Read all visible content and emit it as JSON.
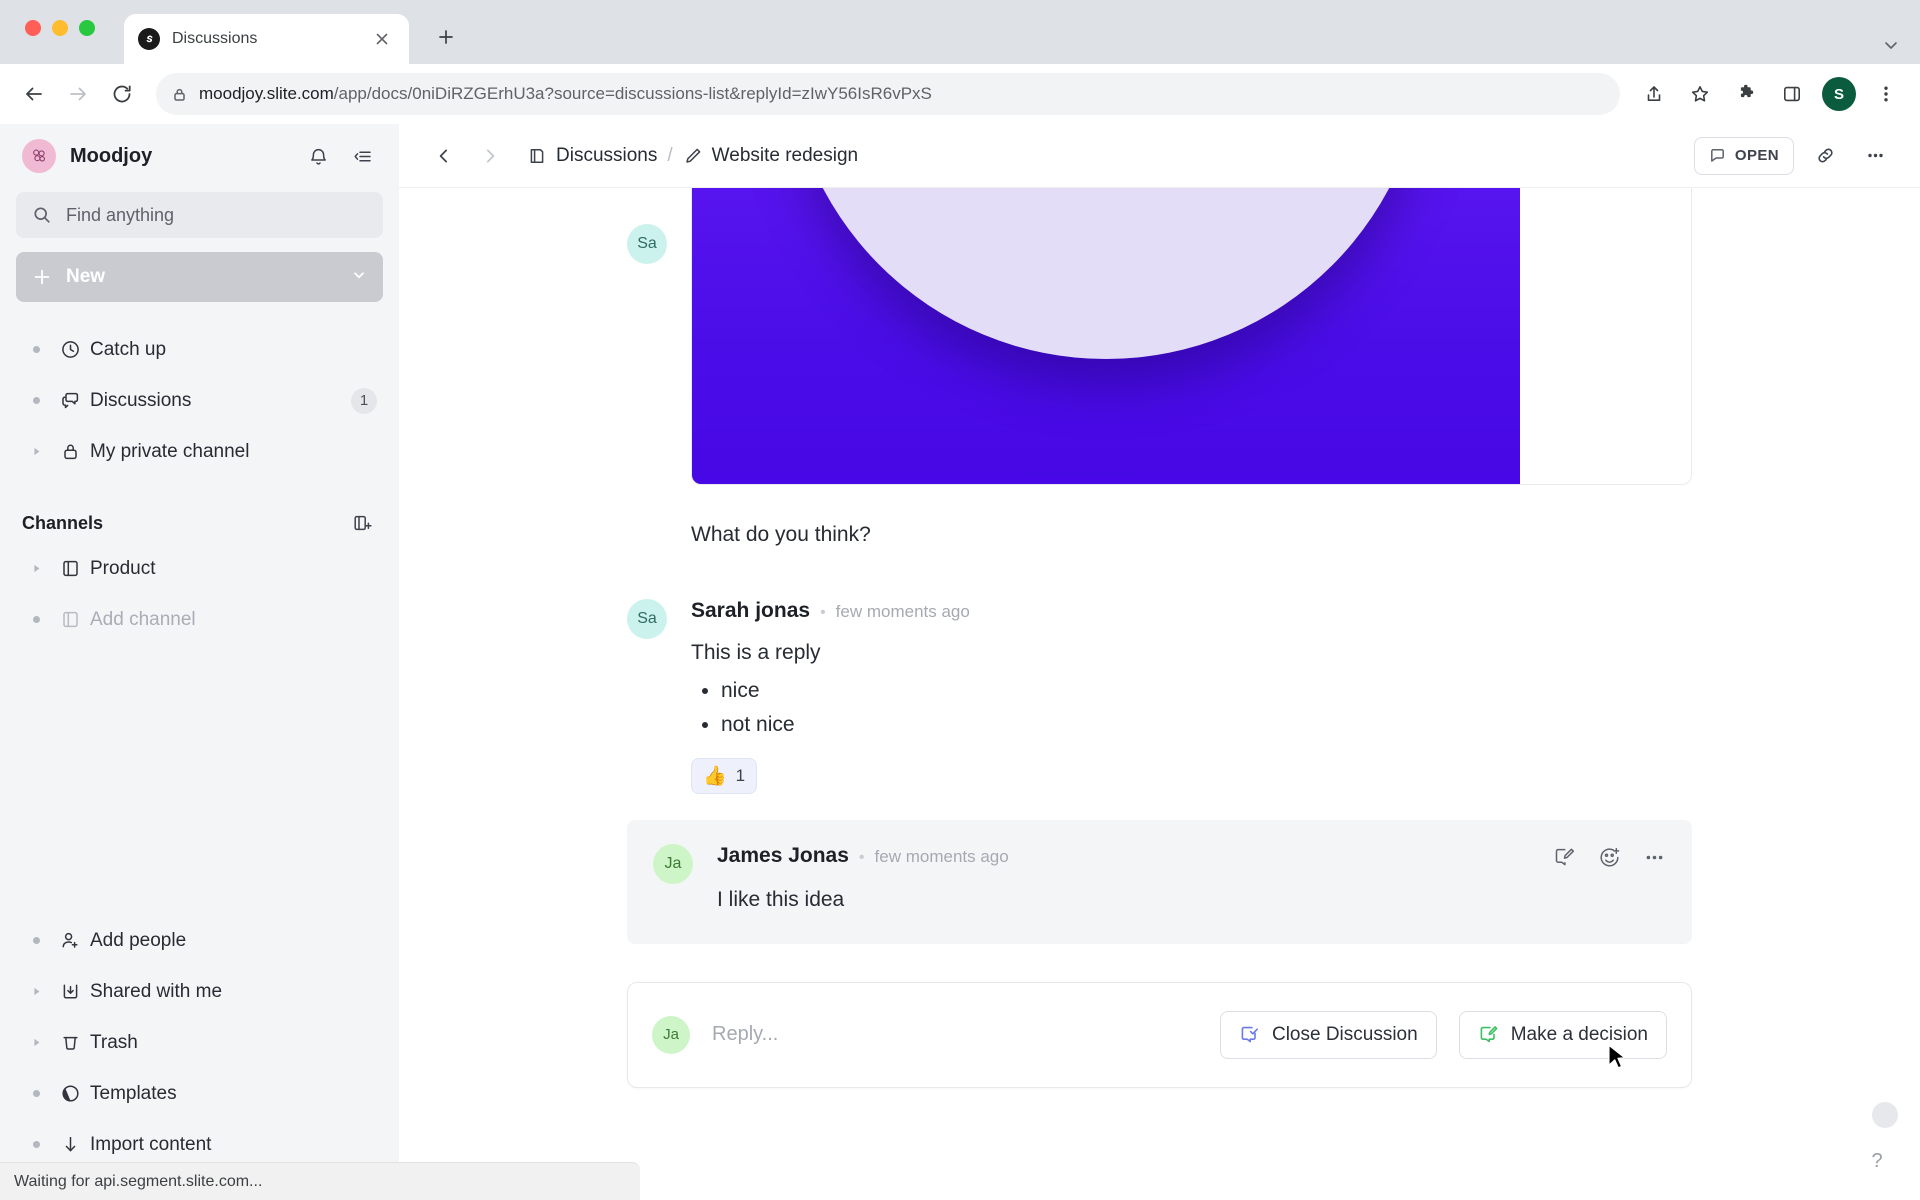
{
  "browser": {
    "tab_title": "Discussions",
    "url_host": "moodjoy.slite.com",
    "url_path": "/app/docs/0niDiRZGErhU3a?source=discussions-list&replyId=zIwY56IsR6vPxS",
    "profile_initial": "S",
    "status_text": "Waiting for api.segment.slite.com...",
    "icons": {
      "back": "back-arrow-icon",
      "forward": "forward-arrow-icon",
      "reload": "reload-icon",
      "lock": "lock-icon",
      "share": "share-icon",
      "bookmark": "star-icon",
      "extensions": "puzzle-icon",
      "sidepanel": "side-panel-icon",
      "menu": "kebab-menu-icon",
      "newtab": "plus-icon",
      "tablist": "chevron-down-icon",
      "tabclose": "close-icon"
    }
  },
  "sidebar": {
    "workspace": "Moodjoy",
    "notifications_icon": "bell-icon",
    "collapse_icon": "collapse-sidebar-icon",
    "search_placeholder": "Find anything",
    "new_button": "New",
    "nav": [
      {
        "label": "Catch up",
        "icon": "clock-icon",
        "marker": "bullet",
        "badge": ""
      },
      {
        "label": "Discussions",
        "icon": "chat-bubble-icon",
        "marker": "bullet",
        "badge": "1"
      },
      {
        "label": "My private channel",
        "icon": "lock-icon",
        "marker": "twisty",
        "badge": ""
      }
    ],
    "channels_title": "Channels",
    "channels_add_icon": "add-channel-icon",
    "channels": [
      {
        "label": "Product",
        "icon": "book-icon",
        "marker": "twisty",
        "muted": false
      },
      {
        "label": "Add channel",
        "icon": "add-doc-icon",
        "marker": "bullet",
        "muted": true
      }
    ],
    "bottom": [
      {
        "label": "Add people",
        "icon": "add-person-icon",
        "marker": "bullet"
      },
      {
        "label": "Shared with me",
        "icon": "inbox-download-icon",
        "marker": "twisty"
      },
      {
        "label": "Trash",
        "icon": "trash-icon",
        "marker": "twisty"
      },
      {
        "label": "Templates",
        "icon": "templates-circle-icon",
        "marker": "bullet"
      },
      {
        "label": "Import content",
        "icon": "download-arrow-icon",
        "marker": "bullet"
      }
    ]
  },
  "topbar": {
    "back_icon": "chevron-left-icon",
    "forward_icon": "chevron-right-icon",
    "breadcrumb_root": "Discussions",
    "breadcrumb_root_icon": "channel-icon",
    "breadcrumb_sep": "/",
    "breadcrumb_current": "Website redesign",
    "breadcrumb_current_icon": "pencil-icon",
    "open_label": "OPEN",
    "open_icon": "discussion-icon",
    "link_icon": "link-icon",
    "more_icon": "kebab-menu-icon"
  },
  "thread": {
    "attachment_author_initials": "Sa",
    "prompt_text": "What do you think?",
    "replies": [
      {
        "initials": "Sa",
        "author": "Sarah jonas",
        "time": "few moments ago",
        "text": "This is a reply",
        "bullets": [
          "nice",
          "not nice"
        ],
        "reaction_emoji": "👍",
        "reaction_count": "1"
      },
      {
        "initials": "Ja",
        "author": "James Jonas",
        "time": "few moments ago",
        "text": "I like this idea",
        "actions": [
          "edit-icon",
          "add-reaction-icon",
          "kebab-menu-icon"
        ]
      }
    ]
  },
  "composer": {
    "initials": "Ja",
    "placeholder": "Reply...",
    "close_label": "Close Discussion",
    "close_icon": "close-discussion-icon",
    "decision_label": "Make a decision",
    "decision_icon": "make-decision-icon"
  },
  "colors": {
    "accent_purple": "#5b16f0",
    "sidebar_bg": "#f4f5f7",
    "avatar_sa": "#cbf2ec",
    "avatar_ja": "#cdf5c8",
    "close_icon": "#6b7ae8",
    "decision_icon": "#3fbf63"
  }
}
